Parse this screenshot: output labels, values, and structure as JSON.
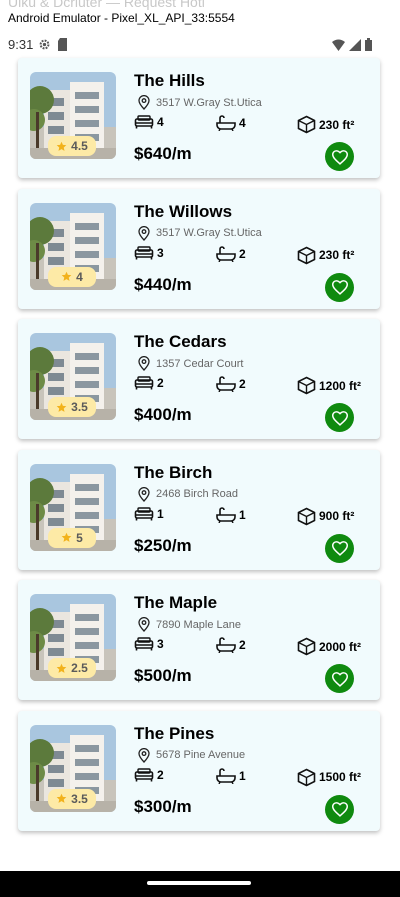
{
  "window": {
    "title": "Android Emulator - Pixel_XL_API_33:5554",
    "ghost_title": "Uiku & Dcriuter — Request Hotl"
  },
  "status": {
    "time": "9:31",
    "icons": [
      "settings-icon",
      "sd-card-icon",
      "wifi-icon",
      "signal-icon",
      "battery-icon"
    ]
  },
  "accent": {
    "card_bg": "#f1fbfd",
    "favorite": "#0f8a0f",
    "rating_bg": "#fdeaa6",
    "star": "#f2b21b"
  },
  "properties": [
    {
      "name": "The Hills",
      "address": "3517 W.Gray St.Utica",
      "beds": "4",
      "baths": "4",
      "area": "230 ft²",
      "price": "$640/m",
      "rating": "4.5"
    },
    {
      "name": "The Willows",
      "address": "3517 W.Gray St.Utica",
      "beds": "3",
      "baths": "2",
      "area": "230 ft²",
      "price": "$440/m",
      "rating": "4"
    },
    {
      "name": "The Cedars",
      "address": "1357 Cedar Court",
      "beds": "2",
      "baths": "2",
      "area": "1200 ft²",
      "price": "$400/m",
      "rating": "3.5"
    },
    {
      "name": "The Birch",
      "address": "2468 Birch Road",
      "beds": "1",
      "baths": "1",
      "area": "900 ft²",
      "price": "$250/m",
      "rating": "5"
    },
    {
      "name": "The Maple",
      "address": "7890 Maple Lane",
      "beds": "3",
      "baths": "2",
      "area": "2000 ft²",
      "price": "$500/m",
      "rating": "2.5"
    },
    {
      "name": "The Pines",
      "address": "5678 Pine Avenue",
      "beds": "2",
      "baths": "1",
      "area": "1500 ft²",
      "price": "$300/m",
      "rating": "3.5"
    }
  ]
}
